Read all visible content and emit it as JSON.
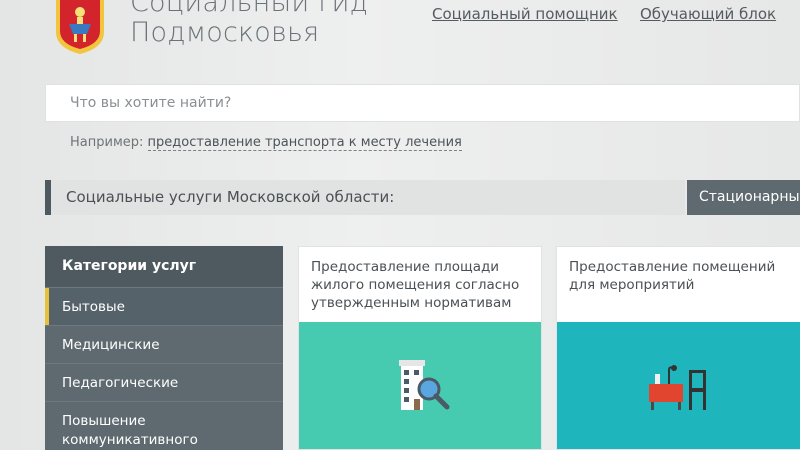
{
  "header": {
    "title_line1": "Социальный гид",
    "title_line2": "Подмосковья",
    "nav": {
      "helper": "Социальный помощник",
      "learning": "Обучающий блок"
    }
  },
  "search": {
    "placeholder": "Что вы хотите найти?",
    "value": "",
    "example_label": "Например:",
    "example_link": "предоставление транспорта к месту лечения"
  },
  "section": {
    "title": "Социальные услуги Московской области:",
    "tab": "Стационарные"
  },
  "sidebar": {
    "header": "Категории услуг",
    "items": [
      {
        "label": "Бытовые",
        "active": true
      },
      {
        "label": "Медицинские",
        "active": false
      },
      {
        "label": "Педагогические",
        "active": false
      },
      {
        "label": "Повышение коммуникативного",
        "active": false
      }
    ]
  },
  "cards": [
    {
      "title": "Предоставление площади жилого помещения согласно утвержденным нормативам",
      "icon": "building-search-icon",
      "color": "#46cbb0"
    },
    {
      "title": "Предоставление помещений для мероприятий",
      "icon": "event-room-icon",
      "color": "#1fb5bd"
    }
  ],
  "colors": {
    "sidebar_bg": "#5f6a70",
    "active_marker": "#e8c13a",
    "section_tab": "#5f6a70"
  }
}
